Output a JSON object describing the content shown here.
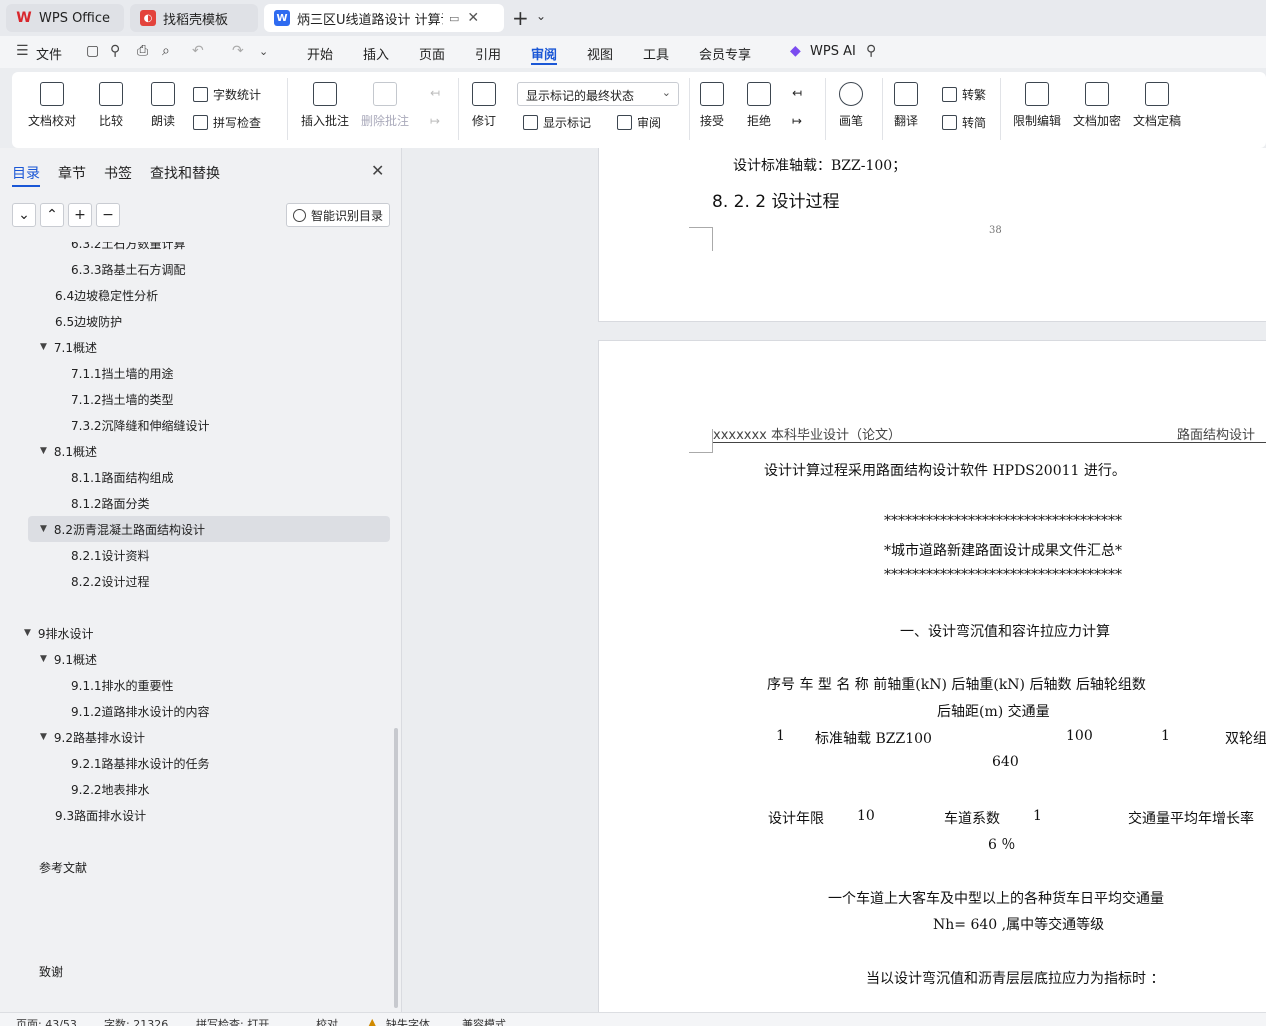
{
  "tabs": [
    {
      "label": "WPS Office",
      "icon": "wps-logo-icon",
      "color": "#d8262c"
    },
    {
      "label": "找稻壳模板",
      "icon": "docer-icon",
      "color": "#e3433c"
    },
    {
      "label": "炳三区U线道路设计 计算说明书",
      "icon": "writer-icon",
      "color": "#2f6bf0"
    }
  ],
  "menu": {
    "file": "文件",
    "items": [
      "开始",
      "插入",
      "页面",
      "引用",
      "审阅",
      "视图",
      "工具",
      "会员专享"
    ],
    "active": "审阅",
    "ai": "WPS AI"
  },
  "ribbon": {
    "doc_check": "文档校对",
    "compare": "比较",
    "read_aloud": "朗读",
    "word_count": "字数统计",
    "spell_check": "拼写检查",
    "insert_comment": "插入批注",
    "delete_comment": "删除批注",
    "track_changes": "修订",
    "markup_state": "显示标记的最终状态",
    "show_markup": "显示标记",
    "review": "审阅",
    "accept": "接受",
    "reject": "拒绝",
    "ink": "画笔",
    "translate": "翻译",
    "to_traditional": "转繁",
    "to_simplified": "转简",
    "restrict_edit": "限制编辑",
    "encrypt": "文档加密",
    "finalize": "文档定稿"
  },
  "side": {
    "tabs": [
      "目录",
      "章节",
      "书签",
      "查找和替换"
    ],
    "smart_toc": "智能识别目录",
    "toc": [
      {
        "label": "6.3.2土石方数量计算",
        "level": 3,
        "arrow": false
      },
      {
        "label": "6.3.3路基土石方调配",
        "level": 3,
        "arrow": false
      },
      {
        "label": "6.4边坡稳定性分析",
        "level": 2,
        "arrow": false
      },
      {
        "label": "6.5边坡防护",
        "level": 2,
        "arrow": false
      },
      {
        "label": "7.1概述",
        "level": 2,
        "arrow": true
      },
      {
        "label": "7.1.1挡土墙的用途",
        "level": 3,
        "arrow": false
      },
      {
        "label": "7.1.2挡土墙的类型",
        "level": 3,
        "arrow": false
      },
      {
        "label": "7.3.2沉降缝和伸缩缝设计",
        "level": 3,
        "arrow": false
      },
      {
        "label": "8.1概述",
        "level": 2,
        "arrow": true
      },
      {
        "label": "8.1.1路面结构组成",
        "level": 3,
        "arrow": false
      },
      {
        "label": "8.1.2路面分类",
        "level": 3,
        "arrow": false
      },
      {
        "label": "8.2沥青混凝土路面结构设计",
        "level": 2,
        "arrow": true,
        "selected": true
      },
      {
        "label": "8.2.1设计资料",
        "level": 3,
        "arrow": false
      },
      {
        "label": "8.2.2设计过程",
        "level": 3,
        "arrow": false
      },
      {
        "label": "",
        "level": 0,
        "arrow": false
      },
      {
        "label": "9排水设计",
        "level": 1,
        "arrow": true
      },
      {
        "label": "9.1概述",
        "level": 2,
        "arrow": true
      },
      {
        "label": "9.1.1排水的重要性",
        "level": 3,
        "arrow": false
      },
      {
        "label": "9.1.2道路排水设计的内容",
        "level": 3,
        "arrow": false
      },
      {
        "label": "9.2路基排水设计",
        "level": 2,
        "arrow": true
      },
      {
        "label": "9.2.1路基排水设计的任务",
        "level": 3,
        "arrow": false
      },
      {
        "label": "9.2.2地表排水",
        "level": 3,
        "arrow": false
      },
      {
        "label": "9.3路面排水设计",
        "level": 2,
        "arrow": false
      },
      {
        "label": "",
        "level": 0,
        "arrow": false
      },
      {
        "label": "参考文献",
        "level": 1,
        "arrow": false
      },
      {
        "label": "",
        "level": 0,
        "arrow": false
      },
      {
        "label": "",
        "level": 0,
        "arrow": false
      },
      {
        "label": "",
        "level": 0,
        "arrow": false
      },
      {
        "label": "致谢",
        "level": 1,
        "arrow": false
      }
    ]
  },
  "doc": {
    "page1_line1": "设计标准轴载：BZZ-100；",
    "page1_heading": "8. 2. 2  设计过程",
    "page_number": "38",
    "header_left": "xxxxxxx 本科毕业设计（论文）",
    "header_right": "路面结构设计",
    "p1": "设计计算过程采用路面结构设计软件 HPDS20011 进行。",
    "stars": "**********************************",
    "summary_title": "*城市道路新建路面设计成果文件汇总*",
    "section1": "一、设计弯沉值和容许拉应力计算",
    "table_head1": "序号    车    型    名    称    前轴重(kN)    后轴重(kN)    后轴数    后轴轮组数",
    "table_head2": "后轴距(m)    交通量",
    "row1_no": "1",
    "row1_name": "标准轴载 BZZ100",
    "row1_rear": "100",
    "row1_count": "1",
    "row1_wheel": "双轮组",
    "row1_traffic": "640",
    "design_years_label": "设计年限",
    "design_years": "10",
    "lane_coef_label": "车道系数",
    "lane_coef": "1",
    "growth_label": "交通量平均年增长率",
    "growth": "6 ％",
    "traffic_desc": "一个车道上大客车及中型以上的各种货车日平均交通量",
    "traffic_level": "Nh= 640 ,属中等交通等级",
    "indicator": "当以设计弯沉值和沥青层层底拉应力为指标时 ："
  },
  "status": {
    "page": "页面: 43/53",
    "words": "字数: 21326",
    "spell": "拼写检查: 打开",
    "proof": "校对",
    "missing_font": "缺失字体",
    "compat": "兼容模式"
  }
}
